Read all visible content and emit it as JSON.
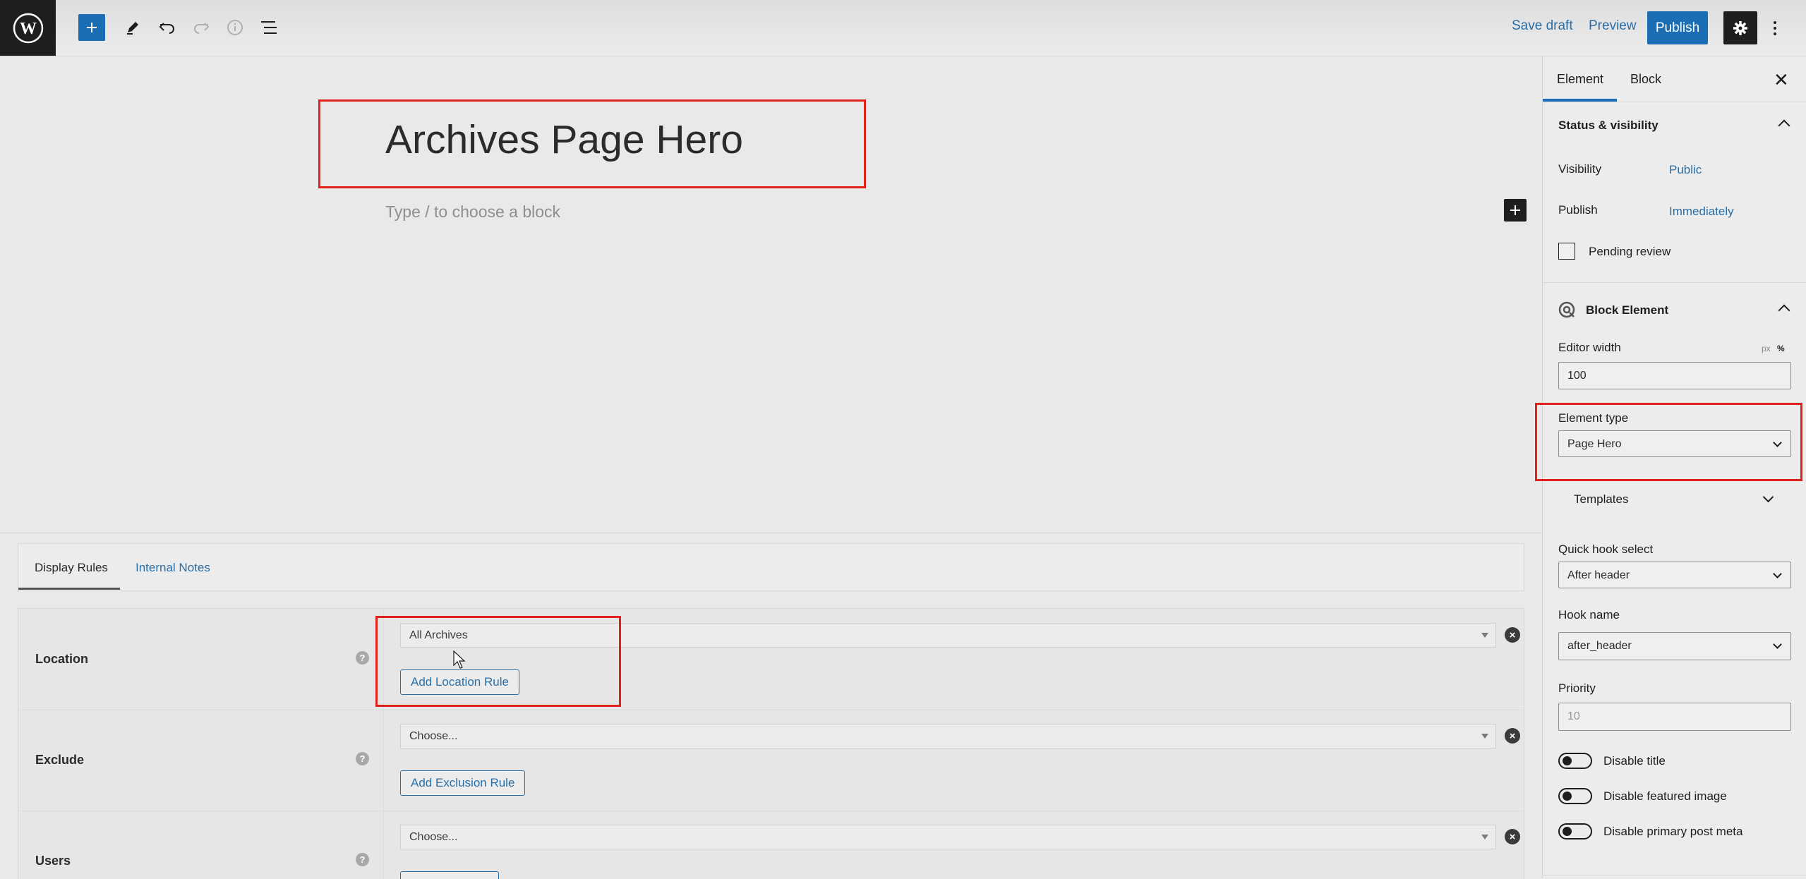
{
  "toolbar": {
    "logo_icon": "wordpress-logo-icon",
    "add_icon": "plus-icon",
    "tool_icons": [
      "pencil-icon",
      "undo-icon",
      "redo-icon",
      "info-icon",
      "list-view-icon"
    ],
    "save_draft": "Save draft",
    "preview": "Preview",
    "publish": "Publish",
    "settings_icon": "gear-icon",
    "more_icon": "vertical-ellipsis-icon"
  },
  "editor": {
    "title": "Archives Page Hero",
    "appender_placeholder": "Type / to choose a block"
  },
  "metabox": {
    "tabs": [
      "Display Rules",
      "Internal Notes"
    ],
    "rules": [
      {
        "label": "Location",
        "select_value": "All Archives",
        "button": "Add Location Rule"
      },
      {
        "label": "Exclude",
        "select_value": "Choose...",
        "button": "Add Exclusion Rule"
      },
      {
        "label": "Users",
        "select_value": "Choose...",
        "button": ""
      }
    ],
    "help_icon": "?"
  },
  "sidebar": {
    "tabs": [
      "Element",
      "Block"
    ],
    "close_icon": "close-icon",
    "status_panel": {
      "title": "Status & visibility",
      "visibility_label": "Visibility",
      "visibility_value": "Public",
      "publish_label": "Publish",
      "publish_value": "Immediately",
      "pending_review": "Pending review"
    },
    "block_element_panel": {
      "title": "Block Element",
      "editor_width_label": "Editor width",
      "unit_px": "px",
      "unit_percent": "%",
      "editor_width_value": "100",
      "element_type_label": "Element type",
      "element_type_value": "Page Hero",
      "templates_label": "Templates",
      "quick_hook_label": "Quick hook select",
      "quick_hook_value": "After header",
      "hook_name_label": "Hook name",
      "hook_name_value": "after_header",
      "priority_label": "Priority",
      "priority_placeholder": "10",
      "toggles": [
        "Disable title",
        "Disable featured image",
        "Disable primary post meta"
      ]
    }
  },
  "colors": {
    "accent": "#1c6eb4",
    "highlight": "#e0211d",
    "link": "#2a6ea6"
  }
}
